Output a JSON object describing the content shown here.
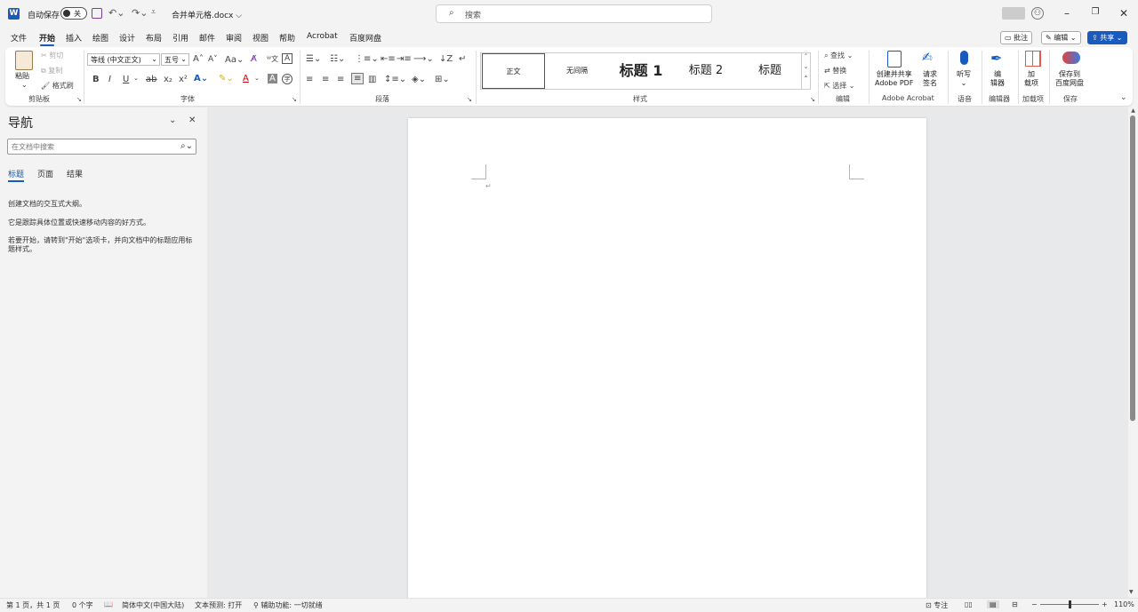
{
  "titlebar": {
    "autosave_label": "自动保存",
    "autosave_state": "关",
    "filename": "合并单元格.docx",
    "filename_chevron": "⌵",
    "search_placeholder": "搜索",
    "icons": [
      "word-icon",
      "save-icon",
      "undo-icon",
      "redo-icon",
      "customize-qat-icon",
      "search-icon",
      "profile-icon",
      "minimize-icon",
      "restore-icon",
      "close-icon"
    ]
  },
  "menu": {
    "items": [
      "文件",
      "开始",
      "插入",
      "绘图",
      "设计",
      "布局",
      "引用",
      "邮件",
      "审阅",
      "视图",
      "帮助",
      "Acrobat",
      "百度网盘"
    ],
    "active": "开始",
    "comment_btn": "批注",
    "edit_btn": "编辑",
    "share_btn": "共享"
  },
  "ribbon": {
    "clipboard": {
      "paste": "粘贴",
      "cut": "剪切",
      "copy": "复制",
      "format_painter": "格式刷",
      "label": "剪贴板"
    },
    "font": {
      "font_name": "等线 (中文正文)",
      "font_size": "五号",
      "label": "字体",
      "bold": "B",
      "italic": "I",
      "underline": "U",
      "strike": "ab",
      "subscript": "x₂",
      "superscript": "x²"
    },
    "paragraph": {
      "label": "段落"
    },
    "styles": {
      "items": [
        "正文",
        "无间隔",
        "标题 1",
        "标题 2",
        "标题"
      ],
      "label": "样式"
    },
    "editing": {
      "find": "查找",
      "replace": "替换",
      "select": "选择",
      "label": "编辑"
    },
    "acrobat": {
      "create_share_line1": "创建并共享",
      "create_share_line2": "Adobe PDF",
      "request_sign_line1": "请求",
      "request_sign_line2": "签名",
      "label": "Adobe Acrobat"
    },
    "voice": {
      "dictate": "听写",
      "label": "语音"
    },
    "editor": {
      "editor_line1": "编",
      "editor_line2": "辑器",
      "label": "编辑器"
    },
    "addins": {
      "addins_line1": "加",
      "addins_line2": "载项",
      "label": "加载项"
    },
    "save": {
      "save_line1": "保存到",
      "save_line2": "百度网盘",
      "label": "保存"
    }
  },
  "nav": {
    "title": "导航",
    "search_placeholder": "在文档中搜索",
    "tabs": [
      "标题",
      "页面",
      "结果"
    ],
    "active_tab": "标题",
    "text1": "创建文档的交互式大纲。",
    "text2": "它是跟踪具体位置或快速移动内容的好方式。",
    "text3": "若要开始，请转到\"开始\"选项卡，并向文档中的标题应用标题样式。"
  },
  "statusbar": {
    "page": "第 1 页，共 1 页",
    "words": "0 个字",
    "language": "简体中文(中国大陆)",
    "text_predictions": "文本预测: 打开",
    "accessibility": "辅助功能: 一切就绪",
    "focus": "专注",
    "zoom": "110%"
  }
}
